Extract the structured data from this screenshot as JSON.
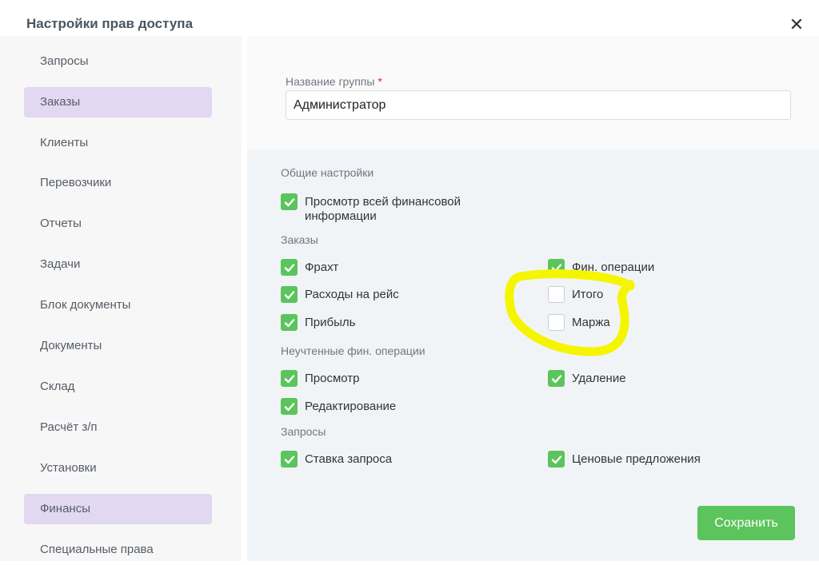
{
  "dialog": {
    "title": "Настройки прав доступа",
    "close_glyph": "✕"
  },
  "sidebar": {
    "items": [
      {
        "label": "Запросы",
        "active": false
      },
      {
        "label": "Заказы",
        "active": true
      },
      {
        "label": "Клиенты",
        "active": false
      },
      {
        "label": "Перевозчики",
        "active": false
      },
      {
        "label": "Отчеты",
        "active": false
      },
      {
        "label": "Задачи",
        "active": false
      },
      {
        "label": "Блок документы",
        "active": false
      },
      {
        "label": "Документы",
        "active": false
      },
      {
        "label": "Склад",
        "active": false
      },
      {
        "label": "Расчёт з/п",
        "active": false
      },
      {
        "label": "Установки",
        "active": false
      },
      {
        "label": "Финансы",
        "active": true
      },
      {
        "label": "Специальные права",
        "active": false
      }
    ]
  },
  "group": {
    "label": "Название группы",
    "required_mark": "*",
    "value": "Администратор"
  },
  "sections": {
    "general": {
      "title": "Общие настройки",
      "items": [
        {
          "label": "Просмотр всей финансовой информации",
          "checked": true
        }
      ]
    },
    "orders": {
      "title": "Заказы",
      "items": [
        {
          "label": "Фрахт",
          "checked": true
        },
        {
          "label": "Фин. операции",
          "checked": true
        },
        {
          "label": "Расходы на рейс",
          "checked": true
        },
        {
          "label": "Итого",
          "checked": false
        },
        {
          "label": "Прибыль",
          "checked": true
        },
        {
          "label": "Маржа",
          "checked": false
        }
      ]
    },
    "unaccounted": {
      "title": "Неучтенные фин. операции",
      "items": [
        {
          "label": "Просмотр",
          "checked": true
        },
        {
          "label": "Удаление",
          "checked": true
        },
        {
          "label": "Редактирование",
          "checked": true
        }
      ]
    },
    "requests": {
      "title": "Запросы",
      "items": [
        {
          "label": "Ставка запроса",
          "checked": true
        },
        {
          "label": "Ценовые предложения",
          "checked": true
        }
      ]
    }
  },
  "actions": {
    "save_label": "Сохранить"
  },
  "colors": {
    "accent_green": "#5cc45c",
    "active_item": "#e2d8f2",
    "highlight": "#f5f500"
  }
}
